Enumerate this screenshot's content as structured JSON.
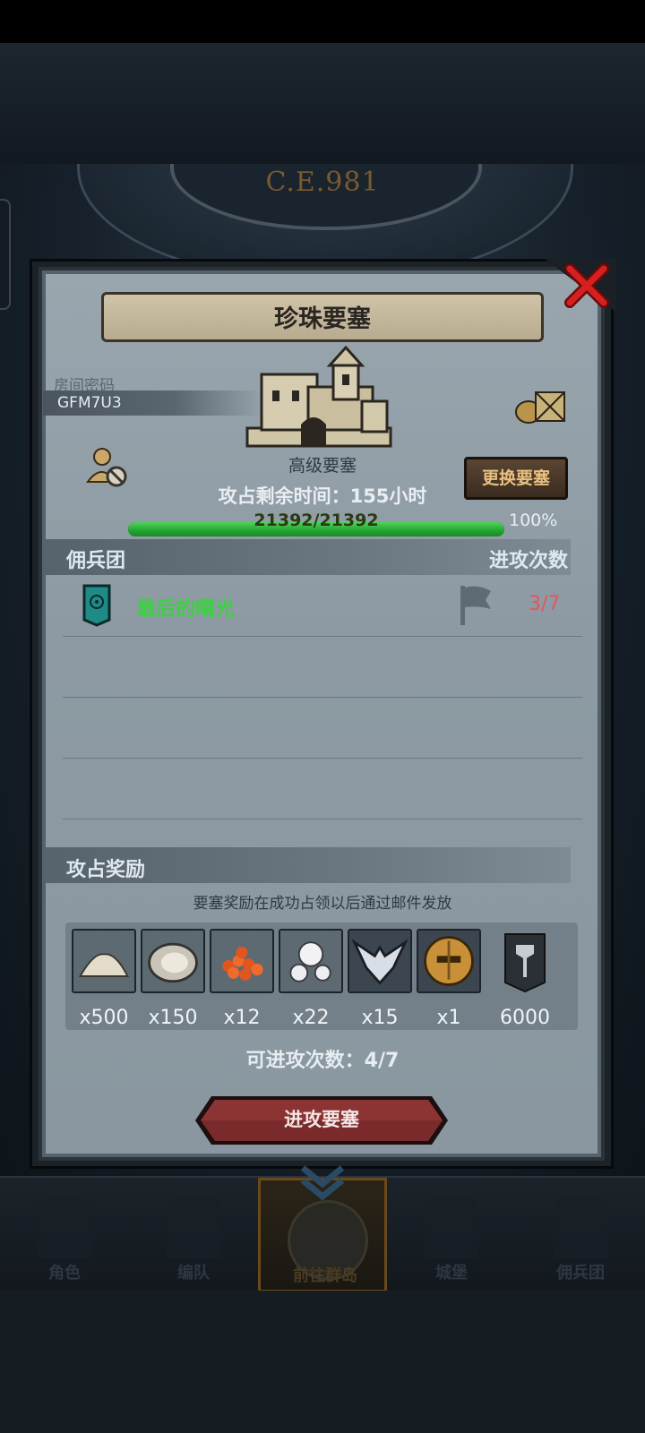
{
  "background": {
    "era_label": "C.E.981"
  },
  "modal": {
    "title": "珍珠要塞",
    "room_code_label": "房间密码",
    "room_code": "GFM7U3",
    "fortress_level": "高级要塞",
    "change_fortress_label": "更换要塞",
    "timer_text": "攻占剩余时间：155小时",
    "hp": {
      "current": 21392,
      "max": 21392,
      "text": "21392/21392",
      "percent_text": "100%",
      "fill_fraction": 1.0
    },
    "mercenary_header": {
      "left": "佣兵团",
      "right": "进攻次数"
    },
    "guilds": [
      {
        "name": "最后的曙光",
        "attacks": "3/7"
      }
    ],
    "rewards_header": "攻占奖励",
    "reward_note": "要塞奖励在成功占领以后通过邮件发放",
    "rewards": [
      {
        "icon": "salt-pile-icon",
        "qty": "x500"
      },
      {
        "icon": "oyster-icon",
        "qty": "x150"
      },
      {
        "icon": "fish-roe-icon",
        "qty": "x12"
      },
      {
        "icon": "pearls-icon",
        "qty": "x22"
      },
      {
        "icon": "winged-emblem-icon",
        "qty": "x15"
      },
      {
        "icon": "gold-helmet-icon",
        "qty": "x1"
      },
      {
        "icon": "banner-axe-icon",
        "qty": "6000"
      }
    ],
    "attack_times_text": "可进攻次数：4/7",
    "attack_button_label": "进攻要塞"
  },
  "bottom_nav": [
    {
      "label": "角色"
    },
    {
      "label": "编队"
    },
    {
      "label": "前往群岛",
      "active": true
    },
    {
      "label": "城堡"
    },
    {
      "label": "佣兵团"
    }
  ],
  "colors": {
    "hp_green": "#22a531",
    "guild_name_green": "#3fcf44",
    "attack_count_red": "#e0585a",
    "attack_button_red": "#7a2a2a"
  }
}
